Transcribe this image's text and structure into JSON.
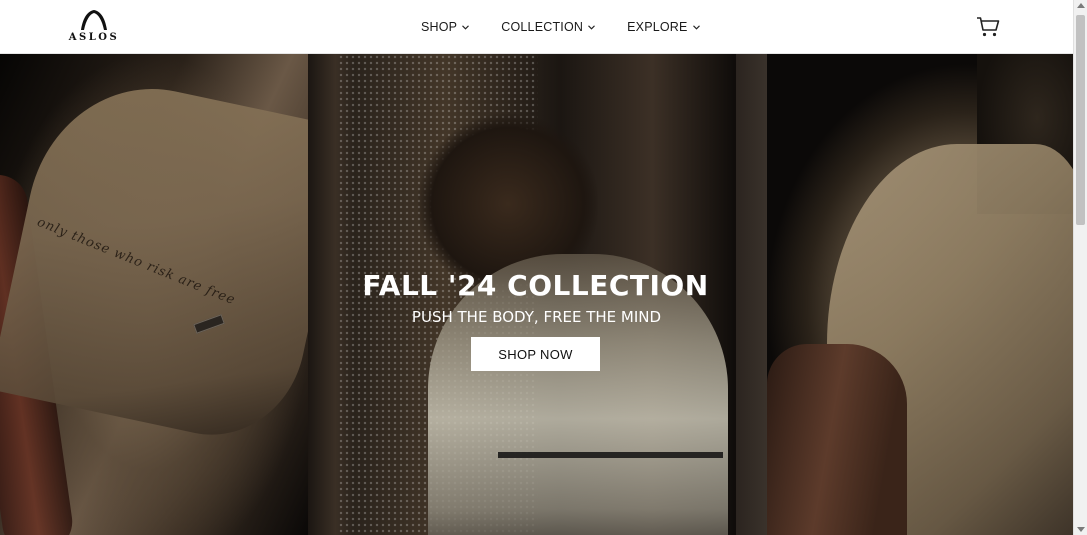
{
  "header": {
    "logo_text": "ASLOS",
    "nav": [
      {
        "label": "SHOP",
        "icon": "chevron-down-icon"
      },
      {
        "label": "COLLECTION",
        "icon": "chevron-down-icon"
      },
      {
        "label": "EXPLORE",
        "icon": "chevron-down-icon"
      }
    ],
    "cart_icon": "cart-icon"
  },
  "hero": {
    "title": "FALL '24 COLLECTION",
    "subtitle": "PUSH THE BODY, FREE THE MIND",
    "cta_label": "SHOP NOW",
    "shirt_script": "only those who risk are free"
  },
  "colors": {
    "header_bg": "#ffffff",
    "text": "#111111",
    "hero_text": "#ffffff",
    "button_bg": "#ffffff"
  }
}
